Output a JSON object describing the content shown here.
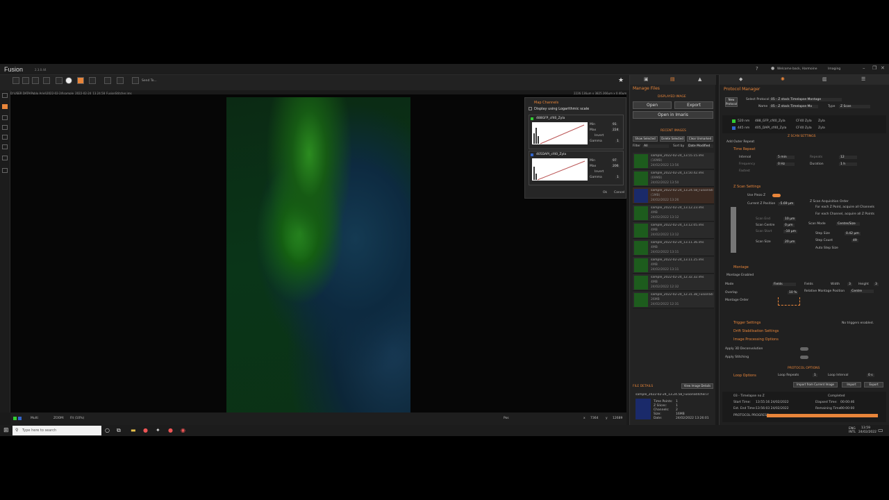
{
  "app": {
    "name": "Fusion",
    "version": "2.3.0.44",
    "welcome": "Welcome back, Harmoine",
    "mode": "Imaging"
  },
  "toolbar": {
    "send_to": "Send To..."
  },
  "viewer": {
    "path": "D:\\USER DATA\\Pablo Ariel\\2022-02-24\\sample_2022-02-24_13.24.58_FusionStitcher.ims",
    "dims": "2226.136µm x 3825.366µm x 0.40µm",
    "zoom_label": "ZOOM:",
    "zoom_value": "Fit (10%)",
    "multi": "Multi",
    "pos": "Pos",
    "x_label": "x",
    "x_val": "7364",
    "y_label": "y",
    "y_val": "12689"
  },
  "map_channels": {
    "title": "Map Channels",
    "log_label": "Display using Logarithmic scale",
    "ch1": {
      "name": "488GFP_cf40_Zyla",
      "min": "91",
      "max": "224",
      "gamma": "1"
    },
    "ch2": {
      "name": "405DAPI_cf40_Zyla",
      "min": "97",
      "max": "206",
      "gamma": "1"
    },
    "min_label": "Min",
    "max_label": "Max",
    "invert_label": "Invert",
    "gamma_label": "Gamma",
    "ok": "Ok",
    "cancel": "Cancel"
  },
  "manage": {
    "title": "Manage Files",
    "displayed": "DISPLAYED IMAGE",
    "open": "Open",
    "export": "Export",
    "imaris": "Open in Imaris",
    "recent": "RECENT IMAGES",
    "show_sel": "Show Selected",
    "del_sel": "Delete Selected",
    "clear": "Clear Unmarked",
    "filter": "Filter",
    "all": "All",
    "sortby": "Sort by",
    "date_mod": "Date Modified",
    "items": [
      {
        "name": "sample_2022-02-24_13.55.15.ims",
        "size": "(16MB)",
        "date": "24/02/2022 13:56"
      },
      {
        "name": "sample_2022-02-24_13.50.42.ims",
        "size": "(69MB)",
        "date": "24/02/2022 13:50"
      },
      {
        "name": "sample_2022-02-24_13.24.58_FusionStitcher",
        "size": "(1MB)",
        "date": "24/02/2022 13:26"
      },
      {
        "name": "sample_2022-02-24_13.12.23.ims",
        "size": "4MB",
        "date": "24/02/2022 13:12"
      },
      {
        "name": "sample_2022-02-24_13.12.05.ims",
        "size": "4MB",
        "date": "24/02/2022 13:12"
      },
      {
        "name": "sample_2022-02-24_13.11.36.ims",
        "size": "4MB",
        "date": "24/02/2022 13:11"
      },
      {
        "name": "sample_2022-02-24_13.11.25.ims",
        "size": "4MB",
        "date": "24/02/2022 13:11"
      },
      {
        "name": "sample_2022-02-24_12.32.32.ims",
        "size": "4MB",
        "date": "24/02/2022 12:32"
      },
      {
        "name": "sample_2022-02-24_12.31.38_FusionStitcher",
        "size": "26MB",
        "date": "24/02/2022 12:31"
      }
    ],
    "file_details": "FILE DETAILS",
    "view_details": "View Image Details",
    "fd_name": "sample_2022-02-24_13.24.58_FusionStitcher.ir",
    "fd": [
      [
        "Time Points:",
        "1"
      ],
      [
        "Z Slices:",
        "1"
      ],
      [
        "Channels:",
        "2"
      ],
      [
        "Size:",
        "16MB"
      ],
      [
        "Date:",
        "24/02/2022 13:26:01"
      ]
    ]
  },
  "protocol": {
    "title": "Protocol Manager",
    "new": "New Protocol",
    "select": "Select Protocol",
    "protocol_name": "05 - Z stack Timelapse Montage",
    "name_label": "Name",
    "name_val": "05 - Z stack Timelapse Mo",
    "type_label": "Type",
    "type_val": "Z Scan",
    "channels": [
      {
        "nm": "520 nm",
        "name": "488_GFP_cf40_Zyla",
        "obj": "CF40 Zyla",
        "cam": "Zyla"
      },
      {
        "nm": "445 nm",
        "name": "405_DAPI_cf40_Zyla",
        "obj": "CF40 Zyla",
        "cam": "Zyla"
      }
    ],
    "z_settings_hdr": "Z SCAN SETTINGS",
    "add_outer": "Add Outer Repeat",
    "time_repeat": "Time Repeat",
    "interval": "Interval",
    "interval_val": "5 min",
    "frequency": "Frequency",
    "freq_val": "0 Hz",
    "fastest": "Fastest",
    "repeats": "Repeats",
    "rep_val": "12",
    "duration": "Duration",
    "dur_val": "1 h",
    "zscan": "Z Scan Settings",
    "use_piezo": "Use Piezo Z",
    "current_z": "Current Z Position",
    "cur_z_val": "-5.69 µm",
    "acq_order": "Z Scan Acquisition Order",
    "order1": "For each Z Point, acquire all Channels",
    "order2": "For each Channel, acquire all Z Points",
    "scan_end": "Scan End",
    "scan_end_val": "10 µm",
    "scan_centre": "Scan Centre",
    "scan_centre_val": "0 µm",
    "scan_start": "Scan Start",
    "scan_start_val": "-10 µm",
    "scan_size": "Scan Size",
    "scan_size_val": "20 µm",
    "scan_mode": "Scan Mode",
    "scan_mode_val": "Centre/Size",
    "step_size": "Step Size",
    "step_val": "0.42 µm",
    "step_count": "Step Count",
    "count_val": "49",
    "auto_step": "Auto Step Size",
    "montage": "Montage",
    "montage_enabled": "Montage Enabled",
    "mode": "Mode",
    "mode_val": "Fields",
    "fields": "Fields",
    "width": "Width",
    "width_val": "3",
    "height": "Height",
    "height_val": "3",
    "overlap": "Overlap",
    "overlap_val": "10 %",
    "rel_pos": "Relative Montage Position",
    "rel_val": "Centre",
    "order": "Montage Order",
    "trigger": "Trigger Settings",
    "no_trig": "No triggers enabled.",
    "drift": "Drift Stabilisation Settings",
    "proc": "Image Processing Options",
    "apply3d": "Apply 3D Deconvolution",
    "stitch": "Apply Stitching",
    "proto_opt": "PROTOCOL OPTIONS",
    "loop": "Loop Options",
    "loop_rep": "Loop Repeats",
    "loop_rep_val": "1",
    "loop_int": "Loop Interval",
    "loop_int_val": "0 s",
    "import_cur": "Import from Current Image",
    "import": "Import",
    "export": "Export",
    "run_name": "03 - Timelapse no Z",
    "status": "Completed",
    "start": "Start Time:",
    "start_val": "13:55:16 24/02/2022",
    "end": "Est. End Time:",
    "end_val": "13:56:03 24/02/2022",
    "elapsed": "Elapsed Time:",
    "elapsed_val": "00:00:46",
    "remaining": "Remaining Time:",
    "remaining_val": "00:00:00",
    "progress_lbl": "PROTOCOL PROGRESS",
    "progress": 1.0
  },
  "taskbar": {
    "search": "Type here to search",
    "lang": "ENG INTL",
    "time": "13:59",
    "date": "24/02/2022"
  }
}
